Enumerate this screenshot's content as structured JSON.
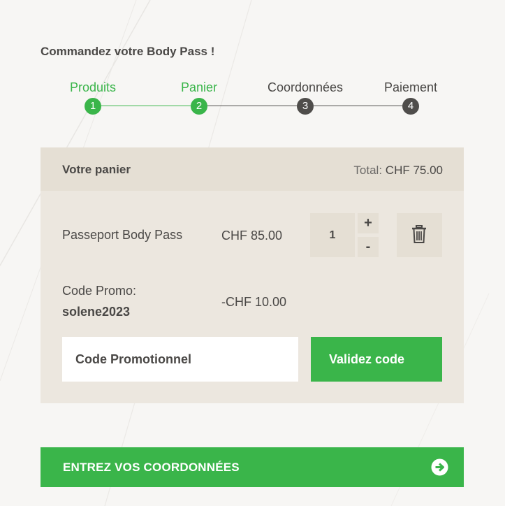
{
  "page": {
    "title": "Commandez votre Body Pass !"
  },
  "stepper": {
    "steps": [
      {
        "label": "Produits",
        "number": "1",
        "state": "active"
      },
      {
        "label": "Panier",
        "number": "2",
        "state": "active"
      },
      {
        "label": "Coordonnées",
        "number": "3",
        "state": "inactive"
      },
      {
        "label": "Paiement",
        "number": "4",
        "state": "inactive"
      }
    ]
  },
  "cart": {
    "title": "Votre panier",
    "total_label": "Total:",
    "total_value": "CHF 75.00",
    "item": {
      "name": "Passeport Body Pass",
      "price": "CHF 85.00",
      "quantity": "1",
      "increment_label": "+",
      "decrement_label": "-",
      "delete_icon": "trash-icon"
    },
    "promo": {
      "label": "Code Promo:",
      "code": "solene2023",
      "discount": "-CHF 10.00",
      "input_value": "",
      "input_placeholder": "Code Promotionnel",
      "validate_label": "Validez code"
    }
  },
  "cta": {
    "label": "ENTREZ VOS COORDONNÉES",
    "icon": "arrow-right-circle-icon"
  },
  "colors": {
    "accent": "#3ab54a",
    "text": "#4a4846",
    "cart_bg": "#ece7df",
    "cart_header_bg": "#e5dfd4",
    "page_bg": "#f7f6f4"
  }
}
